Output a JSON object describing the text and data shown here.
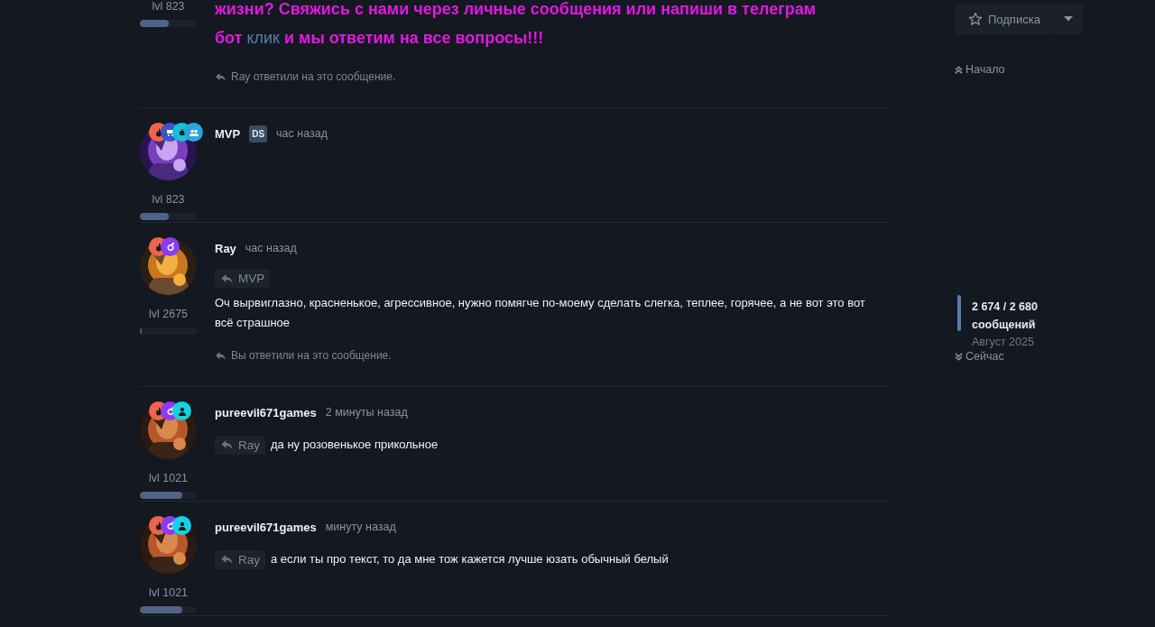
{
  "posts": [
    {
      "kind": "partial",
      "level_label": "lvl 823",
      "level": 0.5,
      "message": {
        "kind": "promo",
        "before": "жизни? Свяжись с нами через личные сообщения или напиши в телеграм бот",
        "link": "клик",
        "after": "и мы ответим на все вопросы!!!"
      },
      "reply_note": "Ray ответили на это сообщение."
    },
    {
      "kind": "full",
      "avatar": {
        "kind": "picture"
      },
      "badges": [
        {
          "kind": "flame",
          "color": "#f0644c"
        },
        {
          "kind": "cart",
          "color": "#3557c8"
        },
        {
          "kind": "bot",
          "color": "#16bfd6"
        },
        {
          "kind": "group",
          "color": "#2aa3de"
        }
      ],
      "author": "MVP",
      "tag": "DS",
      "time": "час назад",
      "level_label": "lvl 823",
      "level": 0.5
    },
    {
      "kind": "full",
      "avatar": {
        "kind": "picture"
      },
      "badges": [
        {
          "kind": "flame",
          "color": "#f0644c"
        },
        {
          "kind": "orb",
          "color": "#8a3cf0"
        }
      ],
      "author": "Ray",
      "time": "час назад",
      "quote": "MVP",
      "text": "Оч вырвиглазно, красненькое, агрессивное, нужно помягче по-моему сделать слегка, теплее, горячее, а не вот это вот всё страшное",
      "reply_note": "Вы ответили на это сообщение.",
      "level_label": "lvl 2675",
      "level": 0.03
    },
    {
      "kind": "full",
      "avatar": {
        "kind": "picture"
      },
      "badges": [
        {
          "kind": "flame",
          "color": "#f0644c"
        },
        {
          "kind": "orb",
          "color": "#8a3cf0"
        },
        {
          "kind": "user",
          "color": "#14d2e6"
        }
      ],
      "author": "pureevil671games",
      "time": "2 минуты назад",
      "quote": "Ray",
      "text": "да ну розовенькое прикольное",
      "level_label": "lvl 1021",
      "level": 0.75
    },
    {
      "kind": "full",
      "avatar": {
        "kind": "picture"
      },
      "badges": [
        {
          "kind": "flame",
          "color": "#f0644c"
        },
        {
          "kind": "orb",
          "color": "#8a3cf0"
        },
        {
          "kind": "user",
          "color": "#14d2e6"
        }
      ],
      "author": "pureevil671games",
      "time": "минуту назад",
      "quote": "Ray",
      "text": "а если ты про текст, то да мне тож кажется лучше юзать обычный белый",
      "level_label": "lvl 1021",
      "level": 0.75
    }
  ],
  "sidebar": {
    "subscribe": "Подписка",
    "start": "Начало",
    "position": "2 674 / 2 680",
    "unit": "сообщений",
    "date": "Август 2025",
    "now": "Сейчас"
  }
}
